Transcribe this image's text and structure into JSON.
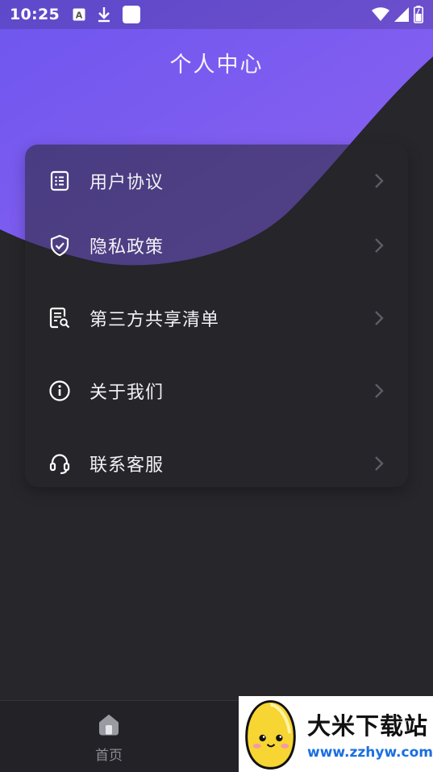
{
  "status_bar": {
    "time": "10:25",
    "left_icons": [
      "a-notification-icon",
      "download-icon",
      "square-notification-icon"
    ],
    "right_icons": [
      "wifi-icon",
      "cellular-signal-icon",
      "battery-icon"
    ]
  },
  "header": {
    "title": "个人中心"
  },
  "menu": {
    "items": [
      {
        "label": "用户协议",
        "icon": "document-list-icon"
      },
      {
        "label": "隐私政策",
        "icon": "shield-check-icon"
      },
      {
        "label": "第三方共享清单",
        "icon": "document-edit-icon"
      },
      {
        "label": "关于我们",
        "icon": "info-circle-icon"
      },
      {
        "label": "联系客服",
        "icon": "headset-icon"
      }
    ]
  },
  "bottom_nav": {
    "home": {
      "label": "首页",
      "icon": "home-icon"
    }
  },
  "watermark": {
    "name": "大米下载站",
    "url": "www.zzhyw.com"
  },
  "colors": {
    "background": "#26262b",
    "wave_start": "#7b5cf0",
    "wave_end": "#9b6cf5",
    "card": "#2a2a30",
    "nav_bg": "#222227",
    "watermark_url": "#1a6fe0"
  }
}
